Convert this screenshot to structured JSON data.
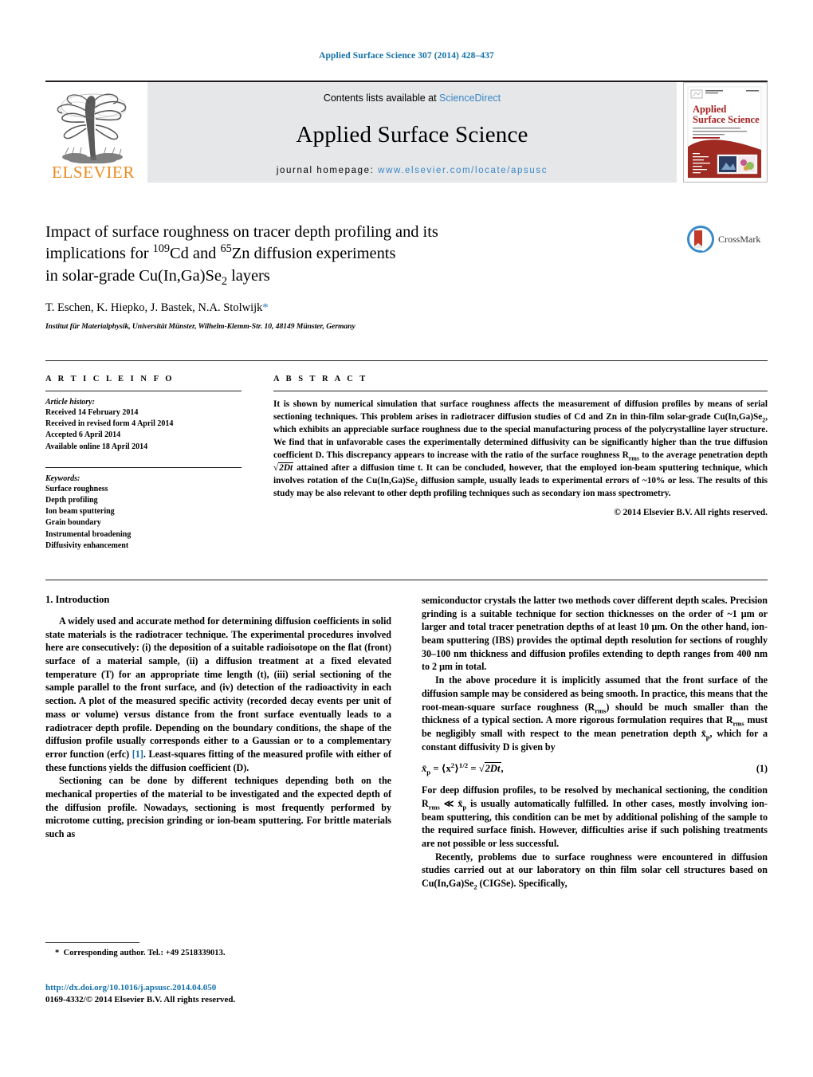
{
  "running_head": "Applied Surface Science 307 (2014) 428–437",
  "masthead": {
    "publisher_name": "ELSEVIER",
    "contents_prefix": "Contents lists available at ",
    "contents_link": "ScienceDirect",
    "journal_title": "Applied Surface Science",
    "homepage_prefix": "journal homepage: ",
    "homepage_url": "www.elsevier.com/locate/apsusc",
    "cover": {
      "journal_name_line1": "Applied",
      "journal_name_line2": "Surface Science"
    },
    "link_color": "#3a86c8",
    "logo_color": "#ec8a1e"
  },
  "crossmark": {
    "label": "CrossMark",
    "ring_color": "#3a8ac8",
    "book_color": "#c0392b"
  },
  "article": {
    "title_line1": "Impact of surface roughness on tracer depth profiling and its",
    "title_line2_pre": "implications for ",
    "title_sup1": "109",
    "title_mid1": "Cd and ",
    "title_sup2": "65",
    "title_mid2": "Zn diffusion experiments",
    "title_line3_pre": "in solar-grade Cu(In,Ga)Se",
    "title_sub": "2",
    "title_line3_post": " layers",
    "authors": "T. Eschen, K. Hiepko, J. Bastek, N.A. Stolwijk",
    "corresponding_marker": "*",
    "affiliation": "Institut für Materialphysik, Universität Münster, Wilhelm-Klemm-Str. 10, 48149 Münster, Germany"
  },
  "article_info": {
    "heading": "A R T I C L E   I N F O",
    "history_label": "Article history:",
    "history": [
      "Received 14 February 2014",
      "Received in revised form 4 April 2014",
      "Accepted 6 April 2014",
      "Available online 18 April 2014"
    ],
    "keywords_label": "Keywords:",
    "keywords": [
      "Surface roughness",
      "Depth profiling",
      "Ion beam sputtering",
      "Grain boundary",
      "Instrumental broadening",
      "Diffusivity enhancement"
    ]
  },
  "abstract": {
    "heading": "A B S T R A C T",
    "part1": "It is shown by numerical simulation that surface roughness affects the measurement of diffusion profiles by means of serial sectioning techniques. This problem arises in radiotracer diffusion studies of Cd and Zn in thin-film solar-grade Cu(In,Ga)Se",
    "sub1": "2",
    "part2": ", which exhibits an appreciable surface roughness due to the special manufacturing process of the polycrystalline layer structure. We find that in unfavorable cases the experimentally determined diffusivity can be significantly higher than the true diffusion coefficient D. This discrepancy appears to increase with the ratio of the surface roughness R",
    "sub2": "rms",
    "part3": " to the average penetration depth ",
    "sqrt1": "2Dt",
    "part4": " attained after a diffusion time t. It can be concluded, however, that the employed ion-beam sputtering technique, which involves rotation of the Cu(In,Ga)Se",
    "sub3": "2",
    "part5": " diffusion sample, usually leads to experimental errors of ~10% or less. The results of this study may be also relevant to other depth profiling techniques such as secondary ion mass spectrometry.",
    "copyright": "© 2014 Elsevier B.V. All rights reserved."
  },
  "body": {
    "section_title": "1.  Introduction",
    "left_para1": "A widely used and accurate method for determining diffusion coefficients in solid state materials is the radiotracer technique. The experimental procedures involved here are consecutively: (i) the deposition of a suitable radioisotope on the flat (front) surface of a material sample, (ii) a diffusion treatment at a fixed elevated temperature (T) for an appropriate time length (t), (iii) serial sectioning of the sample parallel to the front surface, and (iv) detection of the radioactivity in each section. A plot of the measured specific activity (recorded decay events per unit of mass or volume) versus distance from the front surface eventually leads to a radiotracer depth profile. Depending on the boundary conditions, the shape of the diffusion profile usually corresponds either to a Gaussian or to a complementary error function (erfc) ",
    "left_para1_ref": "[1]",
    "left_para1_end": ". Least-squares fitting of the measured profile with either of these functions yields the diffusion coefficient (D).",
    "left_para2": "Sectioning can be done by different techniques depending both on the mechanical properties of the material to be investigated and the expected depth of the diffusion profile. Nowadays, sectioning is most frequently performed by microtome cutting, precision grinding or ion-beam sputtering. For brittle materials such as",
    "right_para1": "semiconductor crystals the latter two methods cover different depth scales. Precision grinding is a suitable technique for section thicknesses on the order of ~1 μm or larger and total tracer penetration depths of at least 10 μm. On the other hand, ion-beam sputtering (IBS) provides the optimal depth resolution for sections of roughly 30–100 nm thickness and diffusion profiles extending to depth ranges from 400 nm to 2 μm in total.",
    "right_para2_a": "In the above procedure it is implicitly assumed that the front surface of the diffusion sample may be considered as being smooth. In practice, this means that the root-mean-square surface roughness (R",
    "right_para2_sub1": "rms",
    "right_para2_b": ") should be much smaller than the thickness of a typical section. A more rigorous formulation requires that R",
    "right_para2_sub2": "rms",
    "right_para2_c": " must be negligibly small with respect to the mean penetration depth x̄",
    "right_para2_sub3": "p",
    "right_para2_d": ", which for a constant diffusivity D is given by",
    "equation": {
      "lhs": "x̄",
      "lhs_sub": "p",
      "middle": "= ⟨x",
      "middle_sup": "2",
      "middle_b": "⟩",
      "middle_sup2": "1/2",
      "eq2": "=",
      "sqrt": "2Dt",
      "tail": ",",
      "number": "(1)"
    },
    "right_para3_a": "For deep diffusion profiles, to be resolved by mechanical sectioning, the condition R",
    "right_para3_sub1": "rms",
    "right_para3_b": " ≪ x̄",
    "right_para3_sub2": "p",
    "right_para3_c": " is usually automatically fulfilled. In other cases, mostly involving ion-beam sputtering, this condition can be met by additional polishing of the sample to the required surface finish. However, difficulties arise if such polishing treatments are not possible or less successful.",
    "right_para4_a": "Recently, problems due to surface roughness were encountered in diffusion studies carried out at our laboratory on thin film solar cell structures based on Cu(In,Ga)Se",
    "right_para4_sub": "2",
    "right_para4_b": " (CIGSe). Specifically,"
  },
  "footer": {
    "corresponding_marker": "*",
    "corresponding_text": "Corresponding author. Tel.: +49 2518339013.",
    "doi": "http://dx.doi.org/10.1016/j.apsusc.2014.04.050",
    "issn": "0169-4332/© 2014 Elsevier B.V. All rights reserved."
  }
}
